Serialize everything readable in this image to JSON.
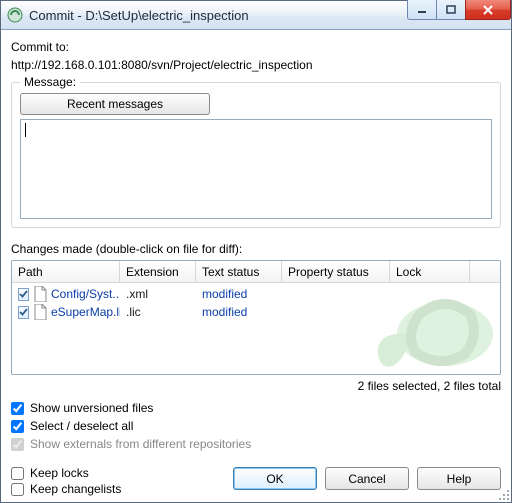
{
  "window": {
    "title": "Commit - D:\\SetUp\\electric_inspection"
  },
  "commit_to_label": "Commit to:",
  "commit_to_url": "http://192.168.0.101:8080/svn/Project/electric_inspection",
  "message_group_label": "Message:",
  "recent_messages_btn": "Recent messages",
  "changes_label": "Changes made (double-click on file for diff):",
  "columns": {
    "path": "Path",
    "ext": "Extension",
    "text": "Text status",
    "prop": "Property status",
    "lock": "Lock"
  },
  "rows": [
    {
      "checked": true,
      "path": "Config/Syst...",
      "ext": ".xml",
      "text": "modified",
      "prop": "",
      "lock": ""
    },
    {
      "checked": true,
      "path": "eSuperMap.lic",
      "ext": ".lic",
      "text": "modified",
      "prop": "",
      "lock": ""
    }
  ],
  "summary": "2 files selected, 2 files total",
  "options": {
    "show_unversioned": {
      "label": "Show unversioned files",
      "checked": true
    },
    "select_all": {
      "label": "Select / deselect all",
      "checked": true
    },
    "show_externals": {
      "label": "Show externals from different repositories",
      "checked": true,
      "disabled": true
    },
    "keep_locks": {
      "label": "Keep locks",
      "checked": false
    },
    "keep_changelists": {
      "label": "Keep changelists",
      "checked": false
    }
  },
  "buttons": {
    "ok": "OK",
    "cancel": "Cancel",
    "help": "Help"
  }
}
